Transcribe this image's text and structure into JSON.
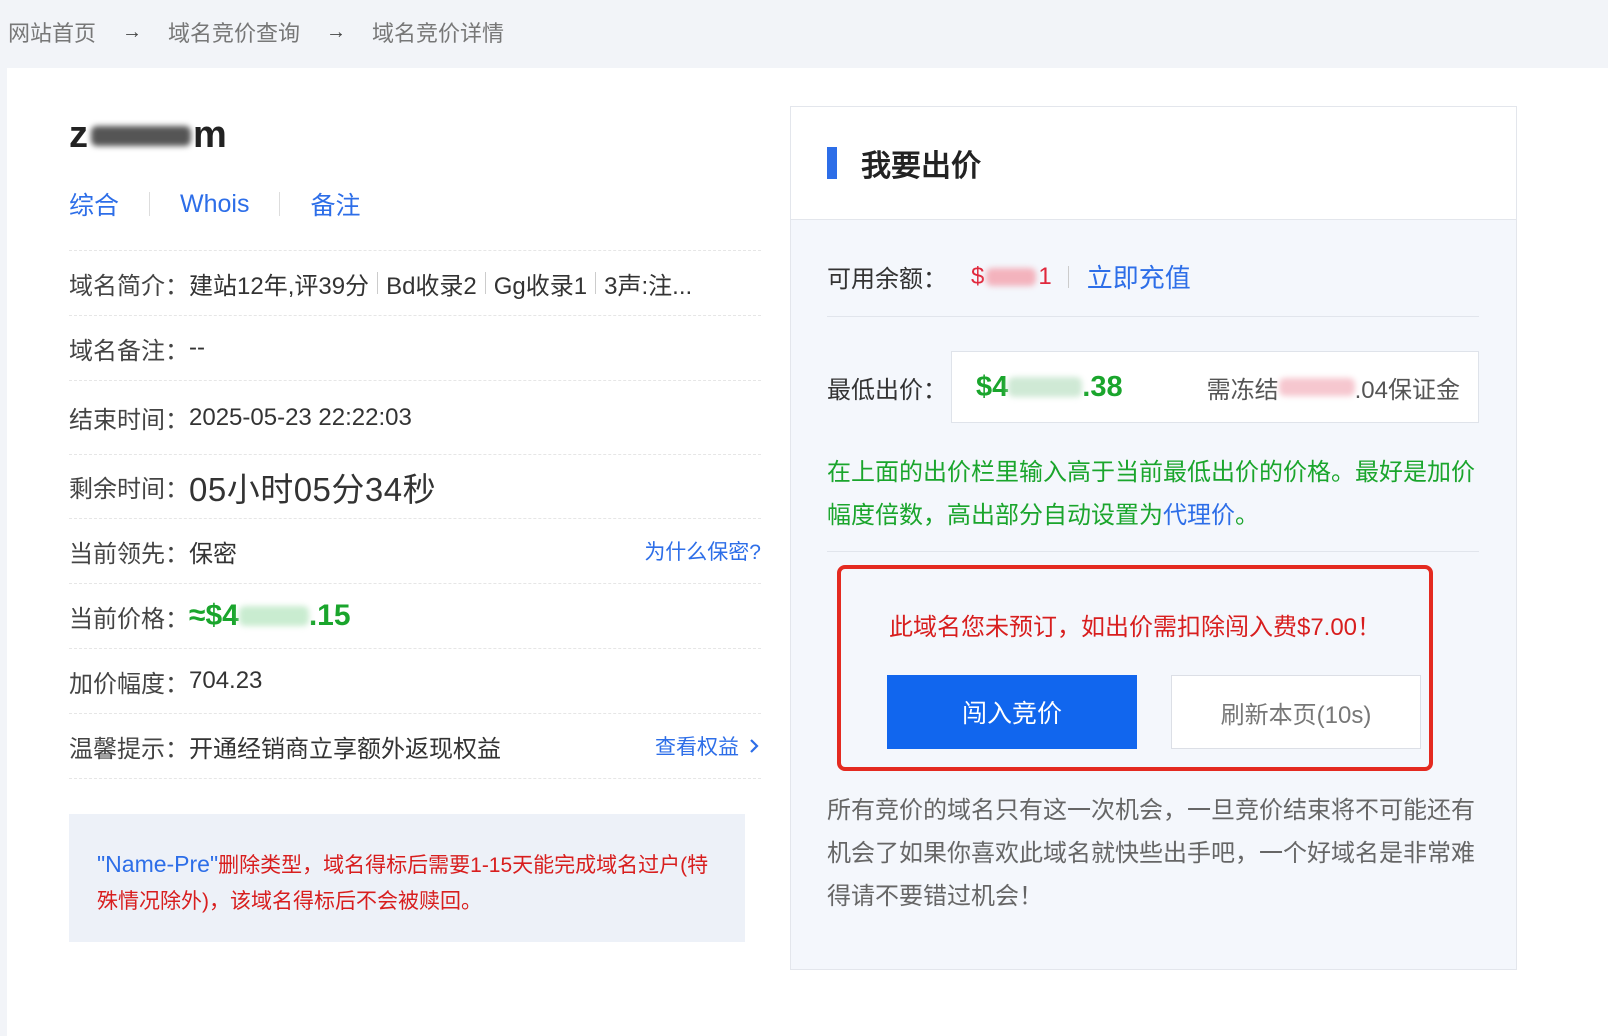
{
  "breadcrumb": {
    "items": [
      "网站首页",
      "域名竞价查询",
      "域名竞价详情"
    ],
    "separator": "→"
  },
  "domain": {
    "name_start": "z",
    "name_end": "m"
  },
  "tabs": [
    "综合",
    "Whois",
    "备注"
  ],
  "info": {
    "intro_label": "域名简介：",
    "intro_parts": [
      "建站12年,评39分",
      "Bd收录2",
      "Gg收录1"
    ],
    "intro_tag": "3声:注...",
    "remark_label": "域名备注：",
    "remark_value": "--",
    "end_label": "结束时间：",
    "end_value": "2025-05-23 22:22:03",
    "remain_label": "剩余时间：",
    "remain_value": "05小时05分34秒",
    "leader_label": "当前领先：",
    "leader_value": "保密",
    "leader_link": "为什么保密?",
    "price_label": "当前价格：",
    "price_prefix": "≈$4",
    "price_suffix": ".15",
    "increment_label": "加价幅度：",
    "increment_value": "704.23",
    "tip_label": "温馨提示：",
    "tip_value": "开通经销商立享额外返现权益",
    "tip_link": "查看权益",
    "tip_link_icon": "chevron-right"
  },
  "notice": {
    "quoted": "\"Name-Pre\"",
    "text": "删除类型，域名得标后需要1-15天能完成域名过户(特殊情况除外)，该域名得标后不会被赎回。"
  },
  "panel": {
    "title": "我要出价",
    "balance_label": "可用余额：",
    "balance_prefix": "$",
    "balance_suffix": "1",
    "recharge": "立即充值",
    "min_bid_label": "最低出价：",
    "min_bid_prefix": "$4",
    "min_bid_suffix": ".38",
    "freeze_prefix": "需冻结",
    "freeze_suffix": ".04保证金",
    "hint_text": "在上面的出价栏里输入高于当前最低出价的价格。最好是加价幅度倍数，高出部分自动设置为",
    "hint_link": "代理价",
    "hint_end": "。",
    "warn": "此域名您未预订，如出价需扣除闯入费$7.00！",
    "bid_button": "闯入竞价",
    "refresh_button": "刷新本页(10s)",
    "footer": "所有竞价的域名只有这一次机会，一旦竞价结束将不可能还有机会了如果你喜欢此域名就快些出手吧，一个好域名是非常难得请不要错过机会！"
  },
  "colors": {
    "accent": "#2d6ee8",
    "price_green": "#1aa52c",
    "warn_red": "#d81e1e",
    "bid_button": "#1166ee"
  }
}
